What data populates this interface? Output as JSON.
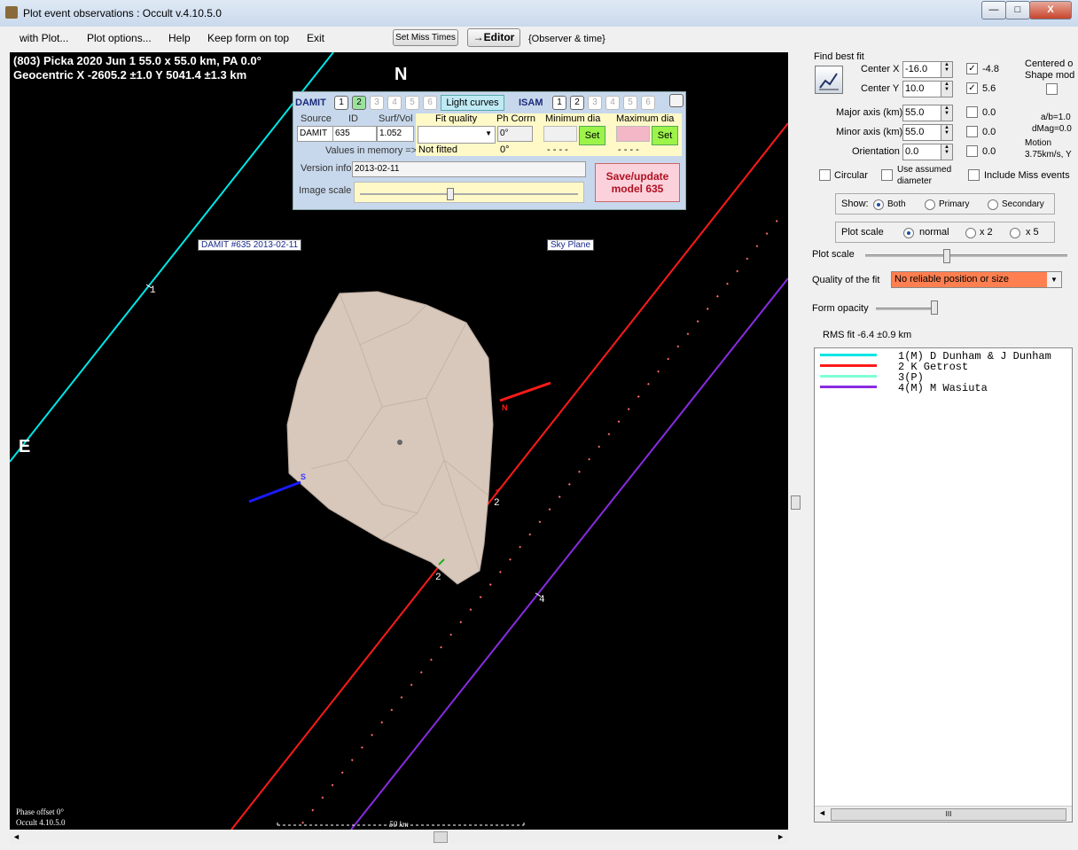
{
  "window": {
    "title": "Plot event observations : Occult v.4.10.5.0",
    "min": "—",
    "max": "□",
    "close": "X"
  },
  "menu": [
    "with Plot...",
    "Plot options...",
    "Help",
    "Keep form on top",
    "Exit"
  ],
  "toolbar": {
    "miss_times": "Set Miss Times",
    "editor": "→Editor",
    "observer_time": "{Observer & time}"
  },
  "plot": {
    "header1": "(803) Picka  2020 Jun 1  55.0 x 55.0 km, PA 0.0°",
    "header2": "Geocentric  X  -2605.2 ±1.0  Y 5041.4 ±1.3 km",
    "north": "N",
    "east": "E",
    "model_label": "DAMIT #635 2013-02-11",
    "sky_plane": "Sky Plane",
    "chord1": "1",
    "chord2a": "2",
    "chord2b": "2",
    "chord4": "4",
    "axis_n": "N",
    "axis_s": "S",
    "phase_offset": "Phase offset 0°",
    "version": "Occult 4.10.5.0",
    "scale": "50 km",
    "colors": {
      "cyan": "#00e5e5",
      "red": "#ff1a1a",
      "purple": "#8a2be2",
      "dot": "#ff6b6b",
      "model": "#d8c8bc"
    }
  },
  "damit": {
    "title": "DAMIT",
    "nums": [
      "1",
      "2",
      "3",
      "4",
      "5",
      "6"
    ],
    "light_curves": "Light curves",
    "isam": "ISAM",
    "isam_nums": [
      "1",
      "2",
      "3",
      "4",
      "5",
      "6"
    ],
    "col_source": "Source",
    "col_id": "ID",
    "col_surf": "Surf/Vol",
    "source": "DAMIT",
    "id": "635",
    "surf": "1.052",
    "values_memory": "Values in memory =>",
    "fit_quality": "Fit quality",
    "ph_corrn": "Ph Corrn",
    "min_dia": "Minimum dia",
    "max_dia": "Maximum dia",
    "ph_value": "0°",
    "not_fitted": "Not fitted",
    "ph_mem": "0°",
    "min_mem": "- - - -",
    "max_mem": "- - - -",
    "set": "Set",
    "version_info": "Version info",
    "version_value": "2013-02-11",
    "image_scale": "Image scale",
    "save1": "Save/update",
    "save2": "model 635"
  },
  "right": {
    "find_best_fit": "Find best fit",
    "center_x": "Center X",
    "center_x_val": "-16.0",
    "center_x_chk": "-4.8",
    "center_y": "Center Y",
    "center_y_val": "10.0",
    "center_y_chk": "5.6",
    "centered1": "Centered o",
    "centered2": "Shape mod",
    "major": "Major axis (km)",
    "major_val": "55.0",
    "major_chk": "0.0",
    "minor": "Minor axis (km)",
    "minor_val": "55.0",
    "minor_chk": "0.0",
    "orient": "Orientation",
    "orient_val": "0.0",
    "orient_chk": "0.0",
    "ab": "a/b=1.0",
    "dmag": "dMag=0.0",
    "motion": "Motion",
    "motion_val": "3.75km/s, Y",
    "circular": "Circular",
    "assumed1": "Use assumed",
    "assumed2": "diameter",
    "include_miss": "Include Miss events",
    "show": "Show:",
    "both": "Both",
    "primary": "Primary",
    "secondary": "Secondary",
    "plot_scale_grp": "Plot scale",
    "normal": "normal",
    "x2": "x 2",
    "x5": "x 5",
    "plot_scale": "Plot scale",
    "quality": "Quality of the fit",
    "quality_val": "No reliable position or size",
    "form_opacity": "Form opacity",
    "rms": "RMS fit -6.4 ±0.9 km"
  },
  "legend": [
    {
      "text": "1(M)  D Dunham & J Dunham",
      "color": "#00e5e5"
    },
    {
      "text": "2     K Getrost",
      "color": "#ff1a1a"
    },
    {
      "text": "3(P)",
      "color": "#7fffd4"
    },
    {
      "text": "4(M)  M Wasiuta",
      "color": "#8a2be2"
    }
  ],
  "scroll": {
    "left": "◄",
    "right": "►",
    "thumb": "III"
  }
}
